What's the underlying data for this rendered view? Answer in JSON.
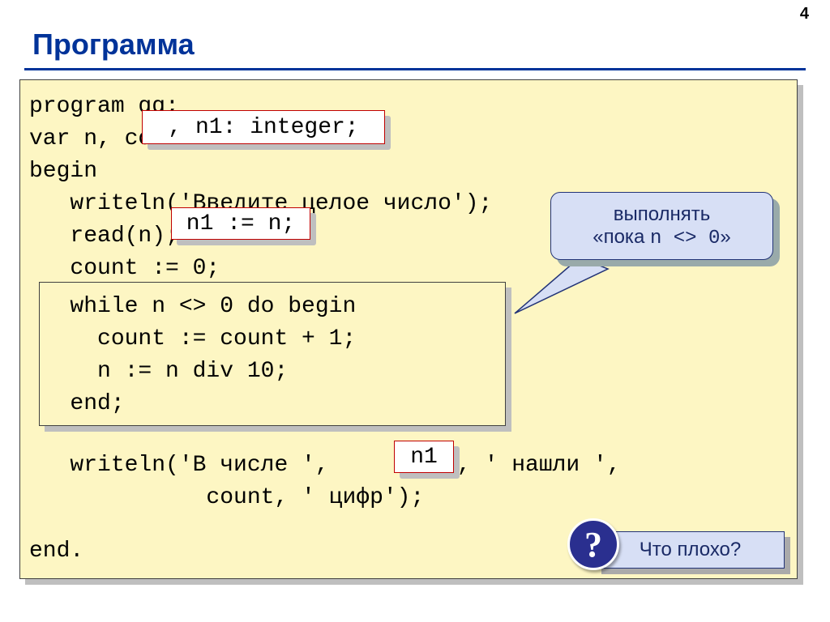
{
  "page_number": "4",
  "title": "Программа",
  "code": {
    "l1": "program qq;",
    "l2": "var n, count",
    "l3": "begin",
    "l4": "   writeln('Введите целое число');",
    "l5": "   read(n);",
    "l6": "   count := 0;",
    "l7": "   while n <> 0 do begin",
    "l8": "     count := count + 1;",
    "l9": "     n := n div 10;",
    "l10": "   end;",
    "l11a": "   writeln('В числе ',",
    "l11b": ", ' нашли ',",
    "l12": "             count, ' цифр');",
    "l13": "end."
  },
  "callouts": {
    "n1_decl": ", n1: integer;",
    "n1_assign": "n1 := n;",
    "n1_use": "n1"
  },
  "note": {
    "line1": "выполнять",
    "line2_prefix": "«пока ",
    "line2_code": "n <> 0",
    "line2_suffix": "»"
  },
  "question": {
    "icon": "?",
    "text": "Что плохо?"
  }
}
